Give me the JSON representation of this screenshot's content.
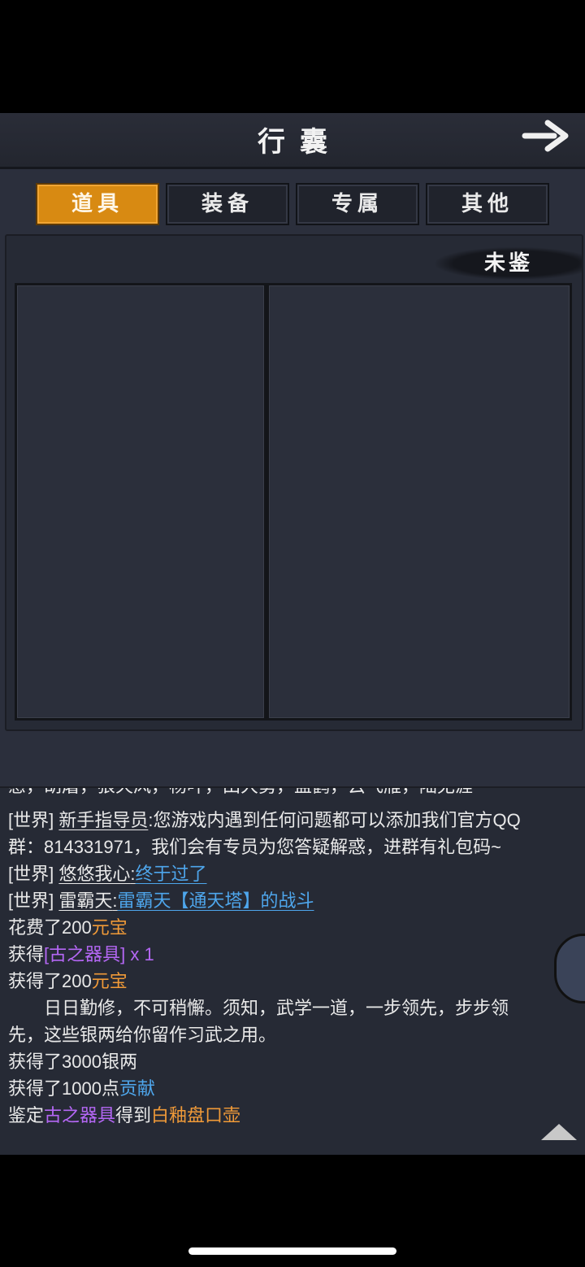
{
  "header": {
    "title": "行囊"
  },
  "tabs": [
    {
      "label": "道具",
      "active": true
    },
    {
      "label": "装备",
      "active": false
    },
    {
      "label": "专属",
      "active": false
    },
    {
      "label": "其他",
      "active": false
    }
  ],
  "inventory": {
    "unidentified_label": "未鉴"
  },
  "chat": {
    "cut_line": "感，胡屠，狼天风，杨叶，田大勇，盖鹤，云飞雁，陆无涯",
    "messages": [
      {
        "channel": "[世界]",
        "sender": "新手指导员",
        "text": ":您游戏内遇到任何问题都可以添加我们官方QQ"
      },
      {
        "text": "群：814331971，我们会有专员为您答疑解惑，进群有礼包码~"
      },
      {
        "channel": "[世界]",
        "sender": "悠悠我心",
        "sep": ":",
        "link": "终于过了"
      },
      {
        "channel": "[世界]",
        "sender": "雷霸天",
        "sep": ":",
        "link": "雷霸天【通天塔】的战斗"
      },
      {
        "prefix": "花费了200",
        "highlight": "元宝"
      },
      {
        "prefix": "获得",
        "item": "[古之器具]",
        "suffix": " x 1"
      },
      {
        "prefix": "获得了200",
        "highlight": "元宝"
      },
      {
        "text": "　　日日勤修，不可稍懈。须知，武学一道，一步领先，步步领"
      },
      {
        "text": "先，这些银两给你留作习武之用。"
      },
      {
        "text": "获得了3000银两"
      },
      {
        "prefix": "获得了1000点",
        "highlight": "贡献"
      },
      {
        "prefix": "鉴定",
        "item": "古之器具",
        "mid": "得到",
        "highlight": "白釉盘口壶"
      }
    ]
  },
  "colors": {
    "tab_active": "#d88a12",
    "link_blue": "#4ea6ec",
    "currency_orange": "#f09a38",
    "item_purple": "#b467f4"
  }
}
